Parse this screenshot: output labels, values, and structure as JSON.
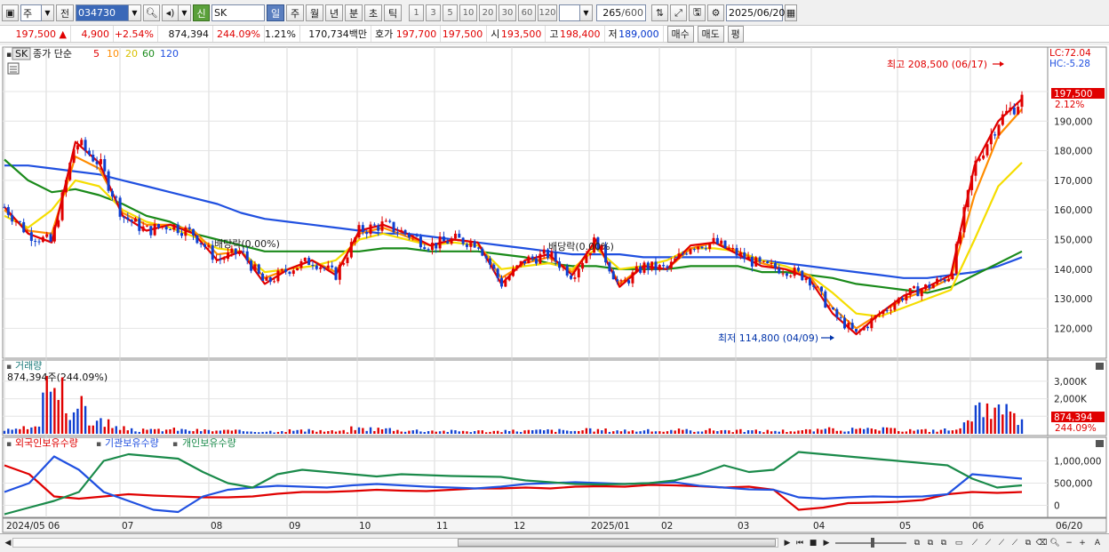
{
  "toolbar": {
    "market": "주",
    "type": "전",
    "code": "034730",
    "badge": "신",
    "name": "SK",
    "periods": [
      "일",
      "주",
      "월",
      "년",
      "분",
      "초",
      "틱"
    ],
    "ticks": [
      "1",
      "3",
      "5",
      "10",
      "20",
      "30",
      "60",
      "120"
    ],
    "count": "265",
    "count_max": "/600",
    "date": "2025/06/20"
  },
  "quote": {
    "price": "197,500 ▲",
    "change": "4,900",
    "rate": "+2.54%",
    "volume": "874,394",
    "vol_ratio": "244.09%",
    "turnover": "1.21%",
    "amount": "170,734백만",
    "ask_label": "호가",
    "ask1": "197,700",
    "ask2": "197,500",
    "open_label": "시",
    "open": "193,500",
    "high_label": "고",
    "high": "198,400",
    "low_label": "저",
    "low": "189,000",
    "buy": "매수",
    "sell": "매도",
    "eval": "평"
  },
  "price_panel": {
    "tag": "SK",
    "legend_title": "종가 단순",
    "ma": [
      {
        "n": "5",
        "color": "#e00000"
      },
      {
        "n": "10",
        "color": "#ff8c00"
      },
      {
        "n": "20",
        "color": "#f2d600"
      },
      {
        "n": "60",
        "color": "#1a8a1a"
      },
      {
        "n": "120",
        "color": "#2050e0"
      }
    ],
    "lc": "LC:72.04",
    "hc": "HC:-5.28",
    "high_note": "최고 208,500 (06/17)",
    "low_note": "최저 114,800 (04/09)",
    "div1": "배당락(0.00%)",
    "div2": "배당락(0.00%)",
    "last_price": "197,500",
    "last_rate": "2.12%",
    "y_ticks": [
      "200,000",
      "190,000",
      "180,000",
      "170,000",
      "160,000",
      "150,000",
      "140,000",
      "130,000",
      "120,000"
    ]
  },
  "volume_panel": {
    "title": "거래량",
    "info": "874,394주(244.09%)",
    "y_ticks": [
      "3,000K",
      "2,000K",
      "1,000K"
    ],
    "last_value": "874,394",
    "last_rate": "244.09%"
  },
  "holdings_panel": {
    "legend": [
      {
        "label": "외국인보유수량",
        "color": "#e00000"
      },
      {
        "label": "기관보유수량",
        "color": "#2050e0"
      },
      {
        "label": "개인보유수량",
        "color": "#1a8a4a"
      }
    ],
    "y_ticks": [
      "1,000,000",
      "500,000",
      "0"
    ]
  },
  "x_axis": {
    "labels": [
      "2024/05",
      "06",
      "07",
      "08",
      "09",
      "10",
      "11",
      "12",
      "2025/01",
      "02",
      "03",
      "04",
      "05",
      "06"
    ],
    "end_label": "06/20"
  },
  "chart_data": [
    {
      "type": "line",
      "title": "",
      "series": [
        {
          "name": "종가 단순 5",
          "values": [
            161000,
            152000,
            149000,
            183000,
            176000,
            158000,
            153000,
            155000,
            152000,
            143000,
            146000,
            135000,
            140000,
            143000,
            138000,
            153000,
            155000,
            152000,
            148000,
            150000,
            149000,
            135000,
            143000,
            145000,
            138000,
            150000,
            134000,
            141000,
            140000,
            148000,
            149000,
            145000,
            141000,
            140000,
            137000,
            125000,
            118000,
            125000,
            131000,
            134000,
            138000,
            175000,
            190000,
            197500
          ]
        },
        {
          "name": "종가 단순 10",
          "values": [
            160000,
            153000,
            152000,
            178000,
            174000,
            159000,
            155000,
            155000,
            153000,
            145000,
            146000,
            137000,
            140000,
            143000,
            139000,
            152000,
            154000,
            151000,
            148000,
            150000,
            149000,
            137000,
            142000,
            144000,
            139000,
            149000,
            135000,
            141000,
            140000,
            147000,
            149000,
            146000,
            142000,
            140000,
            138000,
            127000,
            120000,
            125000,
            130000,
            133000,
            137000,
            165000,
            185000,
            194000
          ]
        },
        {
          "name": "종가 단순 20",
          "values": [
            158000,
            154000,
            160000,
            170000,
            168000,
            160000,
            156000,
            154000,
            151000,
            147000,
            146000,
            139000,
            140000,
            141000,
            143000,
            150000,
            152000,
            150000,
            148000,
            149000,
            148000,
            140000,
            141000,
            142000,
            140000,
            147000,
            140000,
            141000,
            143000,
            147000,
            147000,
            146000,
            143000,
            141000,
            138000,
            132000,
            125000,
            124000,
            127000,
            130000,
            133000,
            150000,
            168000,
            176000
          ]
        },
        {
          "name": "종가 단순 60",
          "values": [
            177000,
            170000,
            166000,
            167000,
            165000,
            162000,
            158000,
            156000,
            152000,
            150000,
            148000,
            146000,
            146000,
            146000,
            146000,
            146000,
            147000,
            147000,
            146000,
            146000,
            146000,
            145000,
            144000,
            142000,
            141000,
            141000,
            140000,
            140000,
            140000,
            141000,
            141000,
            141000,
            139000,
            139000,
            138000,
            137000,
            135000,
            134000,
            133000,
            132000,
            134000,
            138000,
            142000,
            146000
          ]
        },
        {
          "name": "종가 단순 120",
          "values": [
            175000,
            175000,
            174000,
            173000,
            172000,
            170000,
            168000,
            166000,
            164000,
            162000,
            159000,
            157000,
            156000,
            155000,
            154000,
            153000,
            152000,
            152000,
            151000,
            150000,
            149000,
            148000,
            147000,
            146000,
            145000,
            145000,
            145000,
            144000,
            144000,
            144000,
            144000,
            144000,
            143000,
            142000,
            141000,
            140000,
            139000,
            138000,
            137000,
            137000,
            138000,
            139000,
            141000,
            144000
          ]
        }
      ]
    },
    {
      "type": "bar",
      "title": "거래량",
      "series": [
        {
          "name": "거래량",
          "values": [
            200,
            300,
            3200,
            1500,
            700,
            300,
            200,
            250,
            200,
            180,
            160,
            150,
            200,
            180,
            150,
            300,
            280,
            200,
            180,
            160,
            160,
            150,
            180,
            200,
            170,
            220,
            200,
            180,
            160,
            200,
            220,
            180,
            170,
            180,
            200,
            260,
            240,
            260,
            220,
            200,
            230,
            1300,
            1200,
            874
          ]
        }
      ]
    },
    {
      "type": "line",
      "title": "보유수량",
      "series": [
        {
          "name": "외국인보유수량",
          "values": [
            900000,
            700000,
            200000,
            150000,
            200000,
            250000,
            220000,
            200000,
            180000,
            180000,
            200000,
            260000,
            300000,
            300000,
            320000,
            350000,
            330000,
            320000,
            350000,
            380000,
            380000,
            400000,
            380000,
            420000,
            430000,
            420000,
            460000,
            450000,
            430000,
            400000,
            420000,
            350000,
            -100000,
            -50000,
            50000,
            60000,
            80000,
            120000,
            250000,
            300000,
            280000,
            300000
          ]
        },
        {
          "name": "기관보유수량",
          "values": [
            300000,
            500000,
            1100000,
            800000,
            300000,
            100000,
            -100000,
            -150000,
            200000,
            350000,
            400000,
            440000,
            420000,
            400000,
            450000,
            480000,
            450000,
            420000,
            400000,
            380000,
            420000,
            480000,
            500000,
            520000,
            500000,
            480000,
            500000,
            520000,
            440000,
            400000,
            360000,
            350000,
            180000,
            150000,
            180000,
            200000,
            190000,
            200000,
            250000,
            700000,
            650000,
            600000
          ]
        },
        {
          "name": "개인보유수량",
          "values": [
            -200000,
            -50000,
            100000,
            300000,
            1000000,
            1150000,
            1100000,
            1050000,
            750000,
            500000,
            400000,
            700000,
            800000,
            750000,
            700000,
            650000,
            700000,
            680000,
            660000,
            650000,
            640000,
            560000,
            520000,
            480000,
            470000,
            480000,
            500000,
            560000,
            700000,
            900000,
            750000,
            800000,
            1200000,
            1150000,
            1100000,
            1050000,
            1000000,
            950000,
            900000,
            600000,
            400000,
            450000
          ]
        }
      ]
    }
  ]
}
